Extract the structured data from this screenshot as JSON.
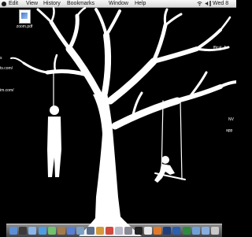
{
  "menubar": {
    "items": [
      "Edit",
      "View",
      "History",
      "Bookmarks",
      "Window",
      "Help"
    ],
    "clock": "Wed 8"
  },
  "desktop": {
    "file_label": "zoom.pdf",
    "edge_labels": {
      "left1": "s",
      "left2": "ts.com/",
      "left3": "im.com/",
      "right1": "ffical_A",
      "right2": "NV",
      "right3": "app"
    }
  },
  "dock": {
    "icons": [
      "finder-icon",
      "dashboard-icon",
      "mail-icon",
      "safari-icon",
      "ichat-icon",
      "address-book-icon",
      "itunes-icon",
      "iphoto-icon",
      "imovie-icon",
      "garageband-icon",
      "ical-icon",
      "preview-icon",
      "system-preferences-icon",
      "terminal-icon",
      "textedit-icon",
      "firefox-icon",
      "photoshop-icon",
      "word-icon",
      "excel-icon",
      "folder-icon",
      "documents-icon",
      "trash-icon"
    ],
    "colors": [
      "#5b8fd6",
      "#3a3a3a",
      "#8bb6e8",
      "#4d9de0",
      "#70c26b",
      "#a37b4c",
      "#5a7ed6",
      "#7ca0c6",
      "#5b6f8c",
      "#d49a3a",
      "#d14a3b",
      "#b8b8c8",
      "#8a8a95",
      "#222222",
      "#e8e8e8",
      "#e07a2c",
      "#1f3d7a",
      "#2b5fb0",
      "#2e8b3d",
      "#6fa1d9",
      "#88aee0",
      "#c9c9c9"
    ]
  }
}
